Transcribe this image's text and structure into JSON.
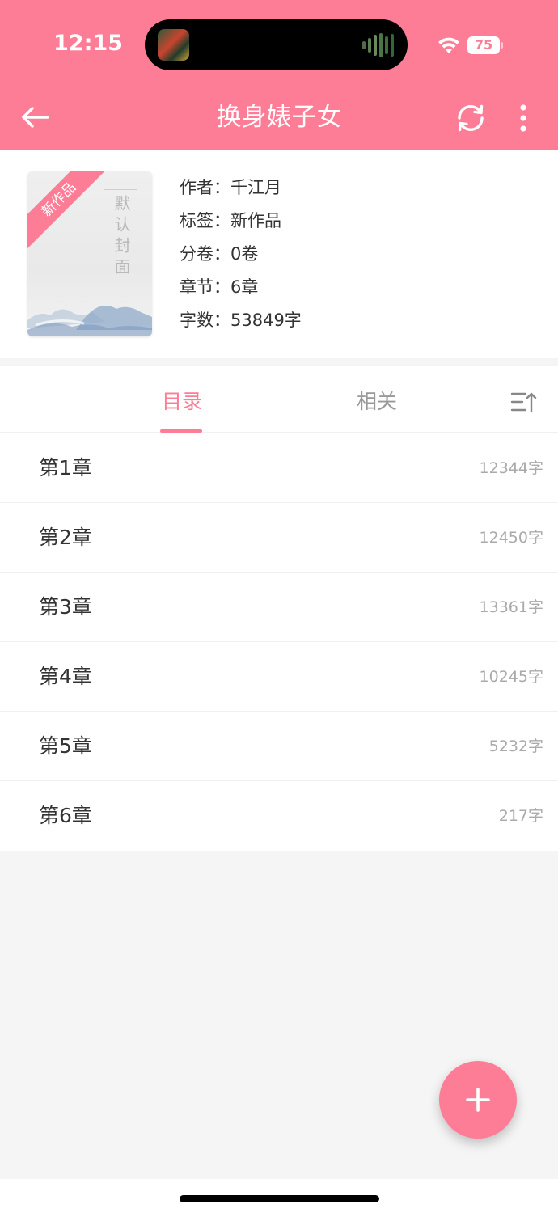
{
  "status_bar": {
    "time": "12:15",
    "battery": "75",
    "icons": [
      "wifi-icon",
      "battery-icon"
    ]
  },
  "nav": {
    "title": "换身婊子女",
    "back_icon": "arrow-left-icon",
    "refresh_icon": "refresh-icon",
    "more_icon": "more-vertical-icon"
  },
  "book": {
    "cover": {
      "ribbon": "新作品",
      "title": "默认封面"
    },
    "meta": [
      {
        "label": "作者：",
        "value": "千江月"
      },
      {
        "label": "标签：",
        "value": "新作品"
      },
      {
        "label": "分卷：",
        "value": "0卷"
      },
      {
        "label": "章节：",
        "value": "6章"
      },
      {
        "label": "字数：",
        "value": "53849字"
      }
    ]
  },
  "tabs": {
    "items": [
      {
        "label": "目录",
        "active": true
      },
      {
        "label": "相关",
        "active": false
      }
    ],
    "sort_icon": "sort-icon"
  },
  "chapters": [
    {
      "title": "第1章",
      "count": "12344字"
    },
    {
      "title": "第2章",
      "count": "12450字"
    },
    {
      "title": "第3章",
      "count": "13361字"
    },
    {
      "title": "第4章",
      "count": "10245字"
    },
    {
      "title": "第5章",
      "count": "5232字"
    },
    {
      "title": "第6章",
      "count": "217字"
    }
  ],
  "fab": {
    "icon": "plus-icon"
  },
  "colors": {
    "accent": "#fd7d96",
    "background": "#f5f5f5",
    "muted_text": "#999999"
  }
}
